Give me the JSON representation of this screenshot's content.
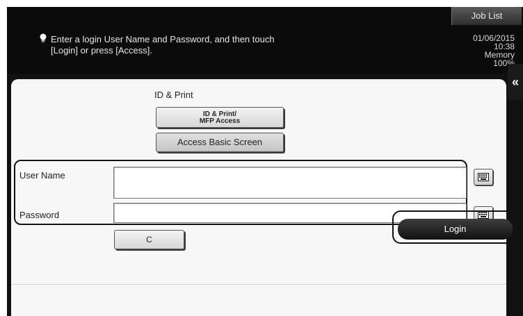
{
  "header": {
    "job_list_label": "Job List",
    "message_line1": "Enter a login User Name and Password, and then touch",
    "message_line2": "[Login] or press [Access].",
    "date": "01/06/2015",
    "time": "10:38",
    "memory_label": "Memory",
    "memory_value": "100%"
  },
  "icons": {
    "message": "lightbulb-icon",
    "collapse": "double-chevron-left-icon",
    "keyboard": "keyboard-icon"
  },
  "auth": {
    "section_label": "ID & Print",
    "id_print_line1": "ID & Print/",
    "id_print_line2": "MFP Access",
    "basic_screen_label": "Access Basic Screen"
  },
  "form": {
    "user_name_label": "User Name",
    "user_name_value": "",
    "password_label": "Password",
    "password_value": "",
    "clear_label": "C"
  },
  "footer": {
    "login_label": "Login"
  }
}
